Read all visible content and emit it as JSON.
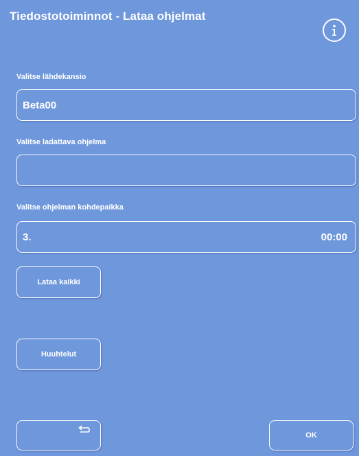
{
  "header": {
    "title": "Tiedostotoiminnot - Lataa ohjelmat",
    "info_icon": "info-icon"
  },
  "source_folder": {
    "label": "Valitse lähdekansio",
    "value": "Beta00"
  },
  "program": {
    "label": "Valitse ladattava ohjelma",
    "value": ""
  },
  "destination": {
    "label": "Valitse ohjelman kohdepaikka",
    "slot": "3.",
    "time": "00:00"
  },
  "buttons": {
    "load_all": "Lataa kaikki",
    "rinses": "Huuhtelut",
    "back_icon": "back-arrow-icon",
    "ok": "OK"
  },
  "colors": {
    "background": "#6f97dc",
    "foreground": "#ffffff"
  }
}
